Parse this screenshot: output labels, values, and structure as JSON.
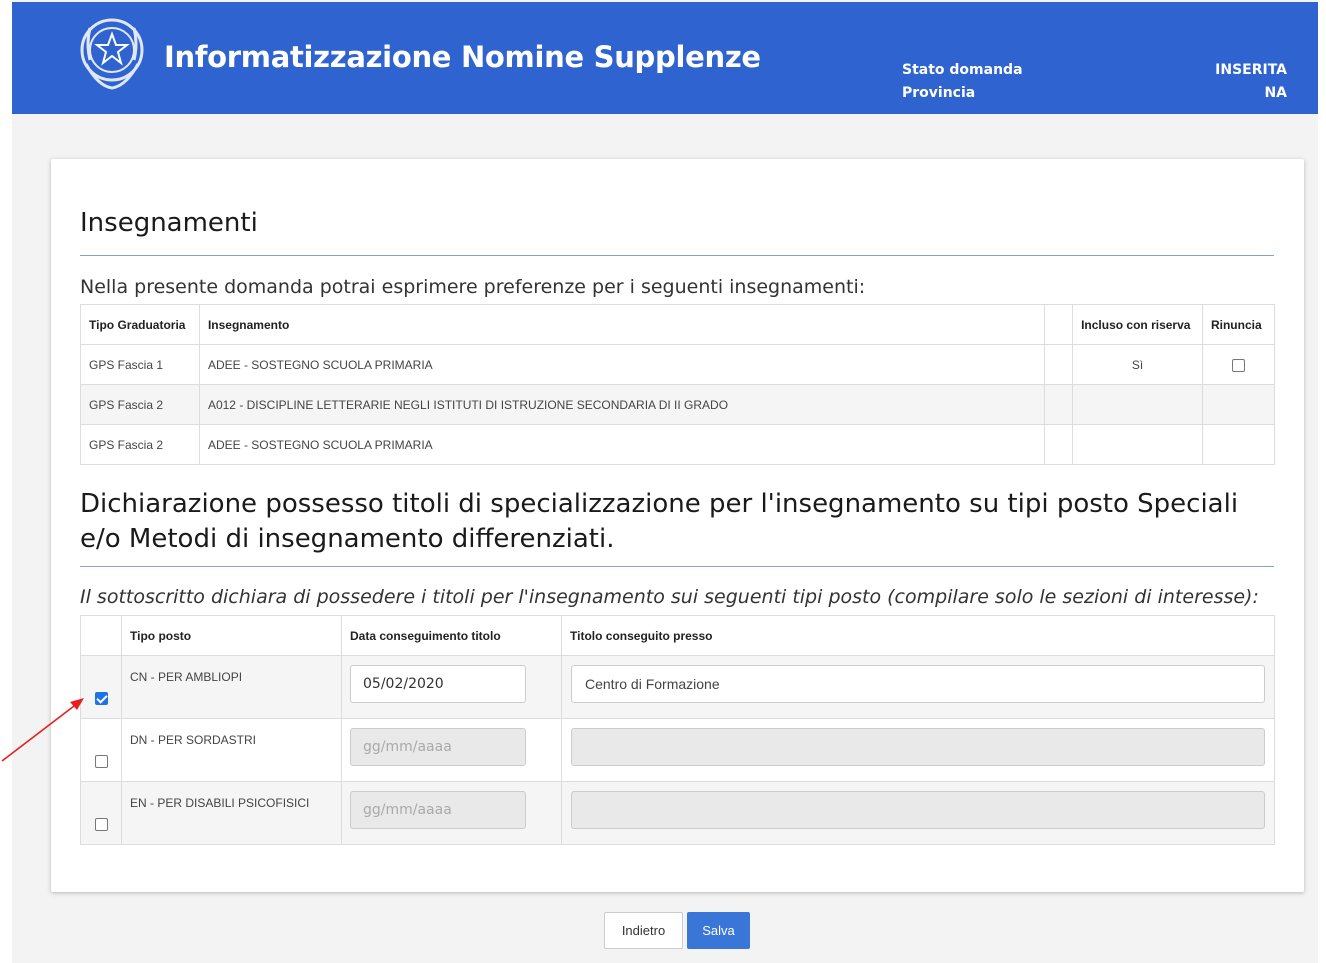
{
  "header": {
    "app_title": "Informatizzazione Nomine Supplenze",
    "status_label": "Stato domanda",
    "status_value": "INSERITA",
    "province_label": "Provincia",
    "province_value": "NA",
    "brand_color": "#2f63d0"
  },
  "insegnamenti": {
    "title": "Insegnamenti",
    "intro": "Nella presente domanda potrai esprimere preferenze per i seguenti insegnamenti:",
    "columns": [
      "Tipo Graduatoria",
      "Insegnamento",
      "",
      "Incluso con riserva",
      "Rinuncia"
    ],
    "rows": [
      {
        "tipo": "GPS Fascia 1",
        "insegnamento": "ADEE - SOSTEGNO SCUOLA PRIMARIA",
        "riserva": "Sì",
        "rinuncia_checkbox": true
      },
      {
        "tipo": "GPS Fascia 2",
        "insegnamento": "A012 - DISCIPLINE LETTERARIE NEGLI ISTITUTI DI ISTRUZIONE SECONDARIA DI II GRADO",
        "riserva": "",
        "rinuncia_checkbox": false
      },
      {
        "tipo": "GPS Fascia 2",
        "insegnamento": "ADEE - SOSTEGNO SCUOLA PRIMARIA",
        "riserva": "",
        "rinuncia_checkbox": false
      }
    ]
  },
  "dichiarazione": {
    "title": "Dichiarazione possesso titoli di specializzazione per l'insegnamento su tipi posto Speciali e/o Metodi di insegnamento differenziati.",
    "intro": "Il sottoscritto dichiara di possedere i titoli per l'insegnamento sui seguenti tipi posto (compilare solo le sezioni di interesse):",
    "columns": [
      "",
      "Tipo posto",
      "Data conseguimento titolo",
      "Titolo conseguito presso"
    ],
    "date_placeholder": "gg/mm/aaaa",
    "rows": [
      {
        "checked": true,
        "tipo_posto": "CN - PER AMBLIOPI",
        "data": "05/02/2020",
        "presso": "Centro di Formazione"
      },
      {
        "checked": false,
        "tipo_posto": "DN - PER SORDASTRI",
        "data": "",
        "presso": ""
      },
      {
        "checked": false,
        "tipo_posto": "EN - PER DISABILI PSICOFISICI",
        "data": "",
        "presso": ""
      }
    ]
  },
  "actions": {
    "back_label": "Indietro",
    "save_label": "Salva"
  }
}
